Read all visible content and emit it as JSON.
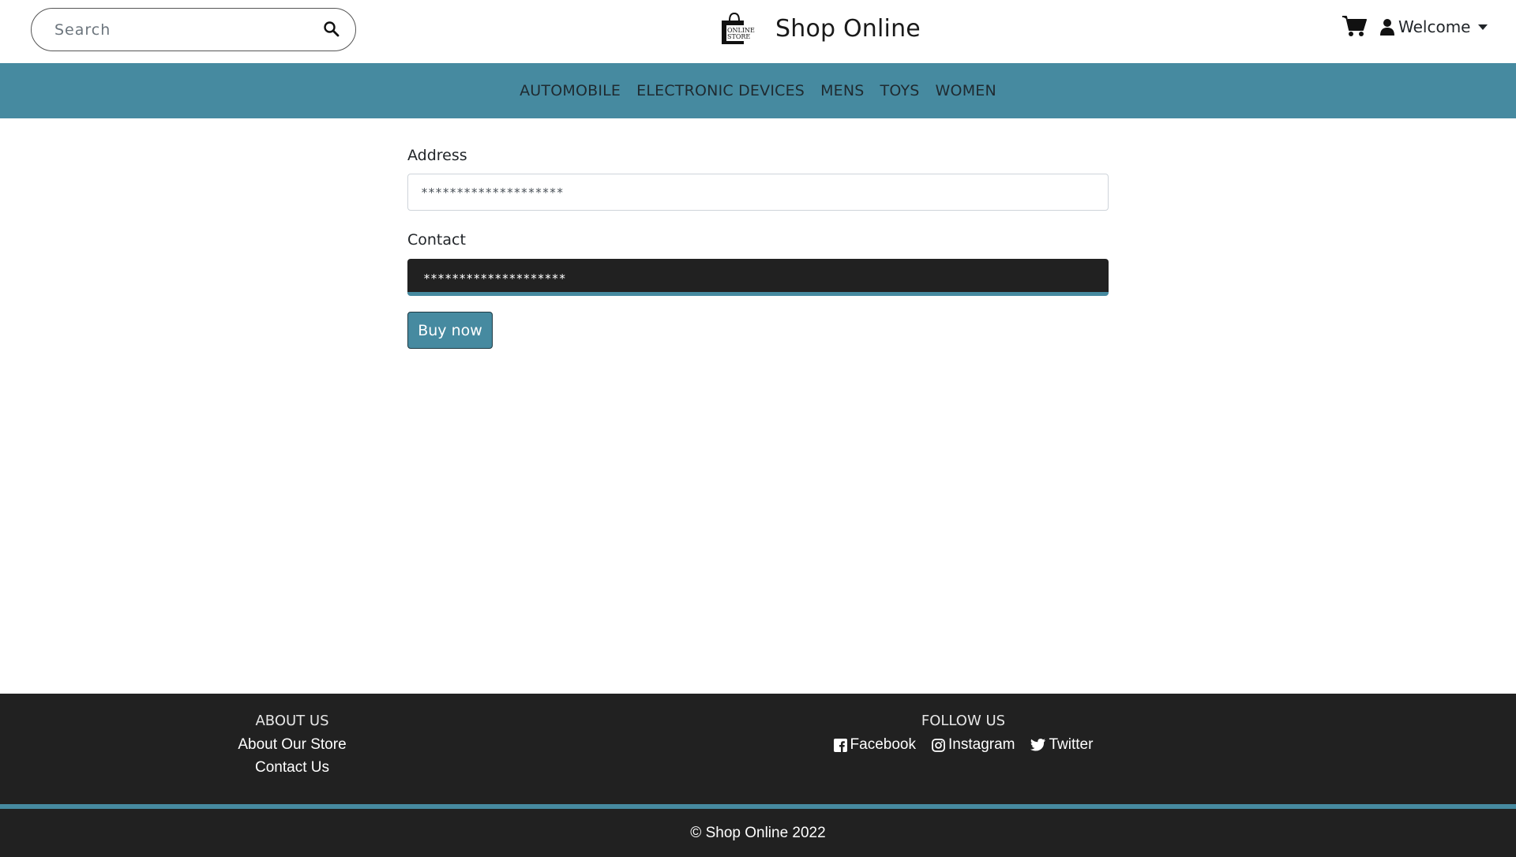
{
  "header": {
    "search": {
      "placeholder": "Search",
      "value": ""
    },
    "brand": {
      "title": "Shop Online",
      "logo_text_1": "ONLINE",
      "logo_text_2": "STORE"
    },
    "user": {
      "welcome_label": "Welcome"
    }
  },
  "nav": {
    "items": [
      {
        "label": "AUTOMOBILE"
      },
      {
        "label": "ELECTRONIC DEVICES"
      },
      {
        "label": "MENS"
      },
      {
        "label": "TOYS"
      },
      {
        "label": "WOMEN"
      }
    ]
  },
  "form": {
    "address": {
      "label": "Address",
      "value": "********************"
    },
    "contact": {
      "label": "Contact",
      "value": "********************"
    },
    "buy_label": "Buy now"
  },
  "footer": {
    "about": {
      "heading": "ABOUT US",
      "links": [
        "About Our Store",
        "Contact Us"
      ]
    },
    "follow": {
      "heading": "FOLLOW US",
      "links": [
        {
          "label": "Facebook",
          "icon": "facebook-icon"
        },
        {
          "label": "Instagram",
          "icon": "instagram-icon"
        },
        {
          "label": "Twitter",
          "icon": "twitter-icon"
        }
      ]
    },
    "copyright": "© Shop Online 2022"
  },
  "colors": {
    "accent": "#468aa0",
    "dark": "#212121"
  }
}
